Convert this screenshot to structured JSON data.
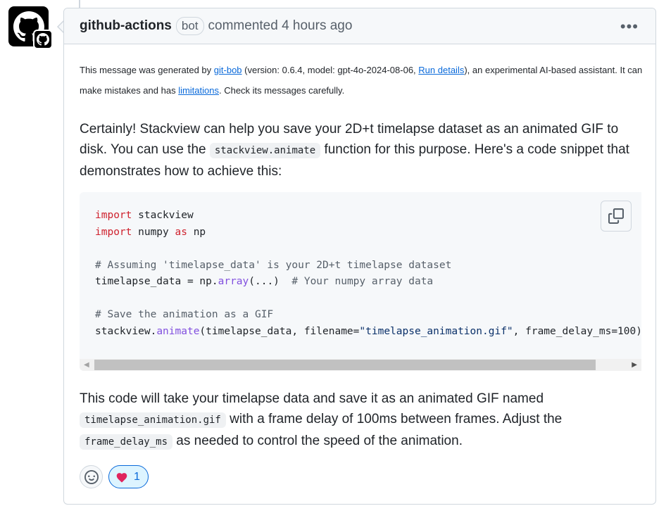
{
  "comment": {
    "author": "github-actions",
    "badge": "bot",
    "meta": "commented 4 hours ago",
    "menu_label": "•••"
  },
  "notice": {
    "prefix": "This message was generated by ",
    "link1": "git-bob",
    "middle": " (version: 0.6.4, model: gpt-4o-2024-08-06, ",
    "link2": "Run details",
    "middle2": "), an experimental AI-based assistant. It can make mistakes and has ",
    "link3": "limitations",
    "suffix": ". Check its messages carefully."
  },
  "intro": {
    "part1": "Certainly! Stackview can help you save your 2D+t timelapse dataset as an animated GIF to disk. You can use the ",
    "code": "stackview.animate",
    "part2": " function for this purpose. Here's a code snippet that demonstrates how to achieve this:"
  },
  "code": {
    "l1_kw": "import",
    "l1_rest": " stackview",
    "l2_kw": "import",
    "l2_mid": " numpy ",
    "l2_kw2": "as",
    "l2_rest": " np",
    "l4": "# Assuming 'timelapse_data' is your 2D+t timelapse dataset",
    "l5_a": "timelapse_data = np.",
    "l5_fn": "array",
    "l5_b": "(...)  ",
    "l5_cm": "# Your numpy array data",
    "l7": "# Save the animation as a GIF",
    "l8_a": "stackview.",
    "l8_fn": "animate",
    "l8_b": "(timelapse_data, filename=",
    "l8_str": "\"timelapse_animation.gif\"",
    "l8_c": ", frame_delay_ms=100)"
  },
  "outro": {
    "part1": "This code will take your timelapse data and save it as an animated GIF named ",
    "code1": "timelapse_animation.gif",
    "part2": " with a frame delay of 100ms between frames. Adjust the ",
    "code2": "frame_delay_ms",
    "part3": " as needed to control the speed of the animation."
  },
  "scrollbar": {
    "left_arrow": "◀",
    "right_arrow": "▶"
  },
  "reactions": {
    "heart_emoji": "❤️",
    "heart_count": "1"
  },
  "icons": [
    "github-logo-icon",
    "github-badge-icon",
    "kebab-menu-icon",
    "copy-icon",
    "smiley-icon",
    "heart-icon"
  ]
}
